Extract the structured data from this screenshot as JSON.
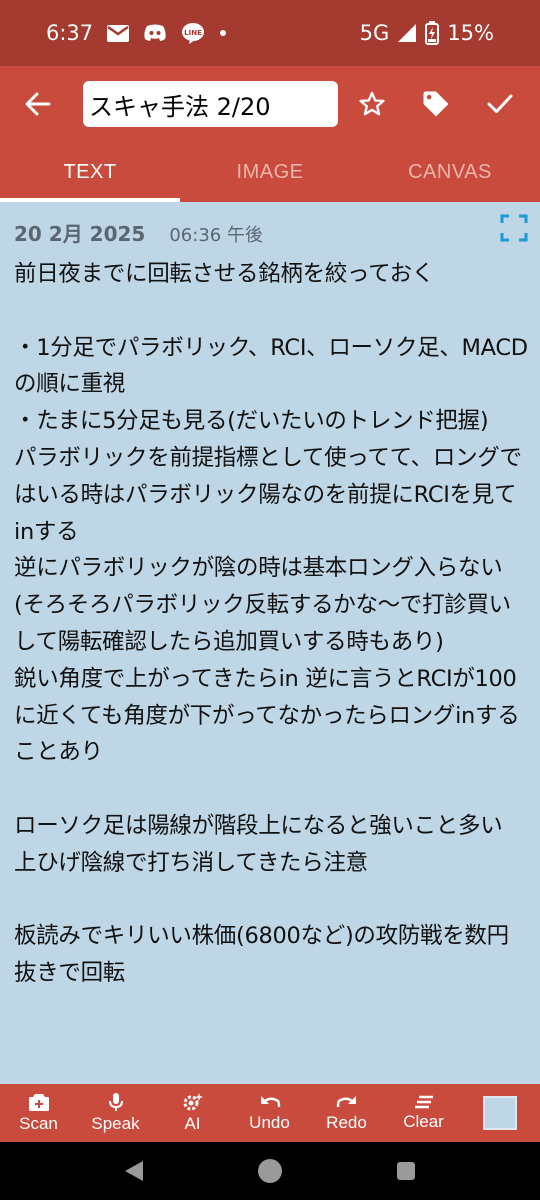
{
  "status_bar": {
    "time": "6:37",
    "network": "5G",
    "battery": "15%",
    "icons": [
      "gmail-icon",
      "discord-icon",
      "line-icon",
      "dot-icon",
      "signal-icon",
      "battery-charging-icon"
    ]
  },
  "app_bar": {
    "title_value": "スキャ手法 2/20",
    "icons": [
      "back-arrow-icon",
      "star-icon",
      "tag-icon",
      "check-icon"
    ]
  },
  "tabs": [
    {
      "label": "TEXT",
      "active": true
    },
    {
      "label": "IMAGE",
      "active": false
    },
    {
      "label": "CANVAS",
      "active": false
    }
  ],
  "note": {
    "date": "20 2月 2025",
    "time": "06:36 午後",
    "body": "前日夜までに回転させる銘柄を絞っておく\n\n・1分足でパラボリック、RCI、ローソク足、MACDの順に重視\n・たまに5分足も見る(だいたいのトレンド把握)\nパラボリックを前提指標として使ってて、ロングではいる時はパラボリック陽なのを前提にRCIを見てinする\n逆にパラボリックが陰の時は基本ロング入らない(そろそろパラボリック反転するかな〜で打診買いして陽転確認したら追加買いする時もあり)\n鋭い角度で上がってきたらin 逆に言うとRCIが100に近くても角度が下がってなかったらロングinすることあり\n\nローソク足は陽線が階段上になると強いこと多い 上ひげ陰線で打ち消してきたら注意\n\n板読みでキリいい株価(6800など)の攻防戦を数円抜きで回転"
  },
  "toolbar": {
    "scan": "Scan",
    "speak": "Speak",
    "ai": "AI",
    "undo": "Undo",
    "redo": "Redo",
    "clear": "Clear"
  },
  "colors": {
    "status_bar": "#a43a30",
    "app_bar": "#c94b3e",
    "content_bg": "#bfd6e6",
    "accent_icon": "#1e9ad6"
  }
}
